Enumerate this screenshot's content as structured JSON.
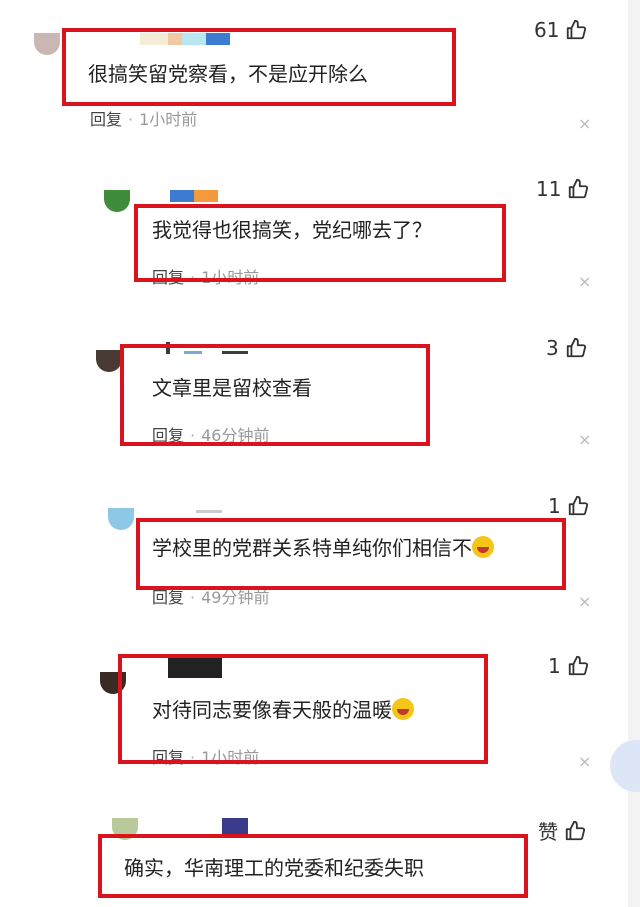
{
  "comments": [
    {
      "text": "很搞笑留党察看，不是应开除么",
      "reply": "回复",
      "time": "1小时前",
      "likes": "61",
      "close": "×",
      "avatar_color": "#c9b7b3",
      "name_colors": [
        "#f5ecd8",
        "#f2c9a5",
        "#b8e7ef",
        "#3c7bd0"
      ]
    },
    {
      "text": "我觉得也很搞笑，党纪哪去了？",
      "reply": "回复",
      "time": "1小时前",
      "likes": "11",
      "close": "×",
      "avatar_color": "#3f8c3a",
      "name_colors": [
        "#3c7bd0",
        "#f59a3c"
      ]
    },
    {
      "text": "文章里是留校查看",
      "reply": "回复",
      "time": "46分钟前",
      "likes": "3",
      "close": "×",
      "avatar_color": "#4a3a34",
      "name_colors": [
        "#7aa8d8",
        "#3c3c3c"
      ]
    },
    {
      "text": "学校里的党群关系特单纯你们相信不",
      "reply": "回复",
      "time": "49分钟前",
      "likes": "1",
      "close": "×",
      "avatar_color": "#8ec8e6",
      "name_colors": [
        "#cccccc"
      ]
    },
    {
      "text": "对待同志要像春天般的温暖",
      "reply": "回复",
      "time": "1小时前",
      "likes": "1",
      "close": "×",
      "avatar_color": "#3a2a24",
      "name_colors": [
        "#222222"
      ]
    },
    {
      "text": "确实，华南理工的党委和纪委失职",
      "reply": "",
      "time": "",
      "likes": "赞",
      "close": "",
      "avatar_color": "#b8c99a",
      "name_colors": [
        "#3a3a8a"
      ]
    }
  ],
  "icons": {
    "like": "thumbs-up-icon",
    "close": "close-icon",
    "emoji_laugh": "laughing-face-icon",
    "emoji_smile": "smiling-face-icon"
  },
  "accent": "#d9141c"
}
